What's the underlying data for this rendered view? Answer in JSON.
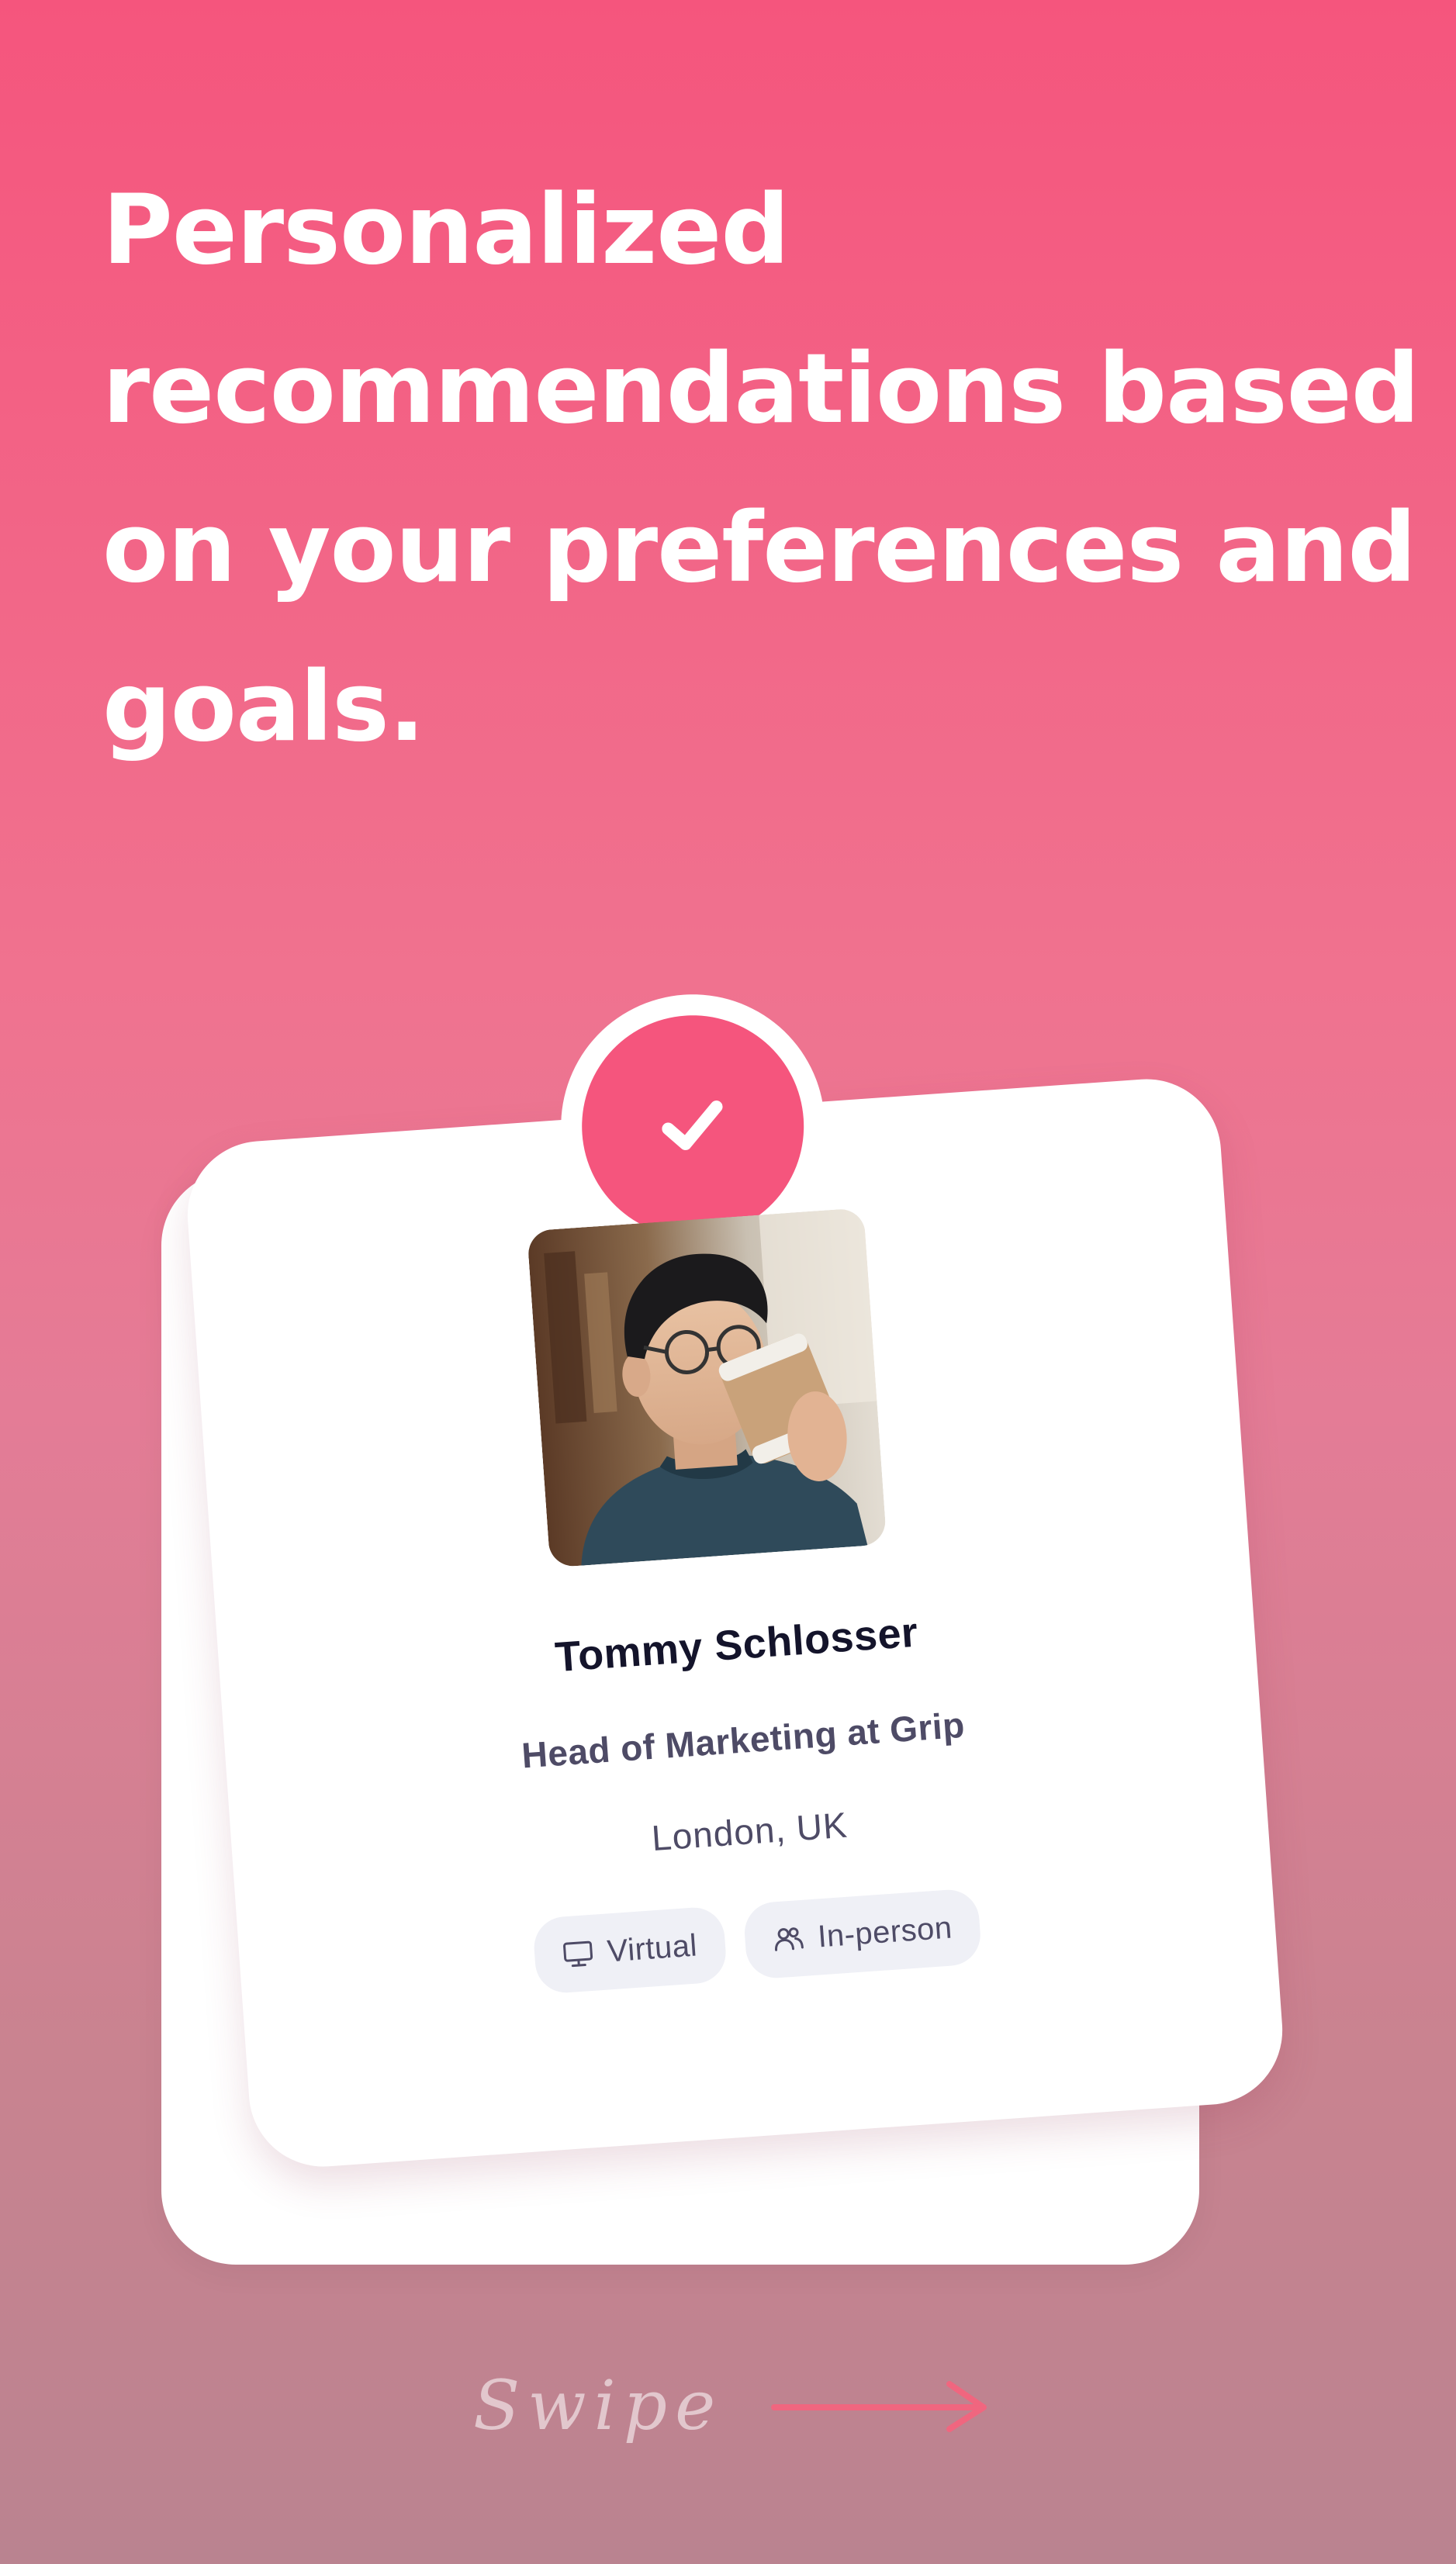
{
  "headline": {
    "lines": [
      "Personalized",
      "recommendations based",
      "on your preferences and",
      "goals."
    ]
  },
  "profile": {
    "name": "Tommy Schlosser",
    "title": "Head of Marketing at Grip",
    "location": "London, UK",
    "tags": [
      {
        "label": "Virtual",
        "icon": "monitor-icon"
      },
      {
        "label": "In-person",
        "icon": "people-icon"
      }
    ],
    "status_icon": "check-icon"
  },
  "footer": {
    "swipe_label": "Swipe",
    "arrow_icon": "arrow-right-icon"
  },
  "colors": {
    "accent": "#f5557d",
    "swipe_arrow": "#f0667f",
    "text_dark": "#14142b",
    "text_muted": "#4e4b66",
    "tag_bg": "#eff0f6"
  }
}
